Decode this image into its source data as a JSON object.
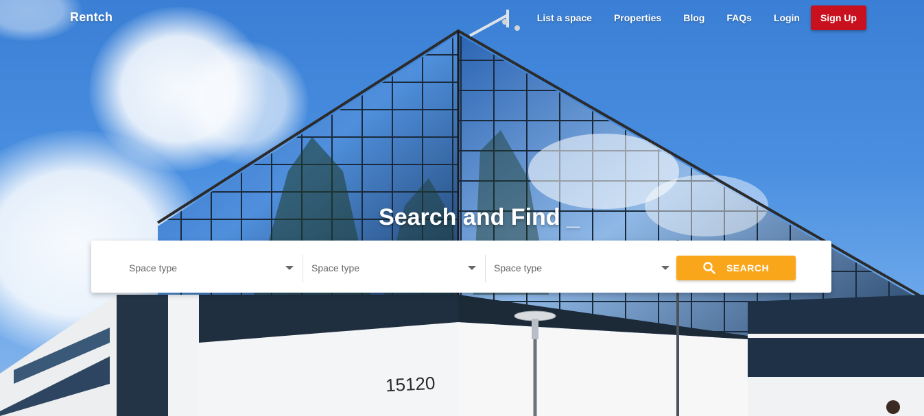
{
  "brand": {
    "name": "Rentch"
  },
  "nav": {
    "links": [
      "List a space",
      "Properties",
      "Blog",
      "FAQs",
      "Login"
    ],
    "signup_label": "Sign Up"
  },
  "hero": {
    "headline": "Search and Find _",
    "building_number": "15120"
  },
  "search": {
    "fields": [
      {
        "placeholder": "Space type"
      },
      {
        "placeholder": "Space type"
      },
      {
        "placeholder": "Space type"
      }
    ],
    "button_label": "SEARCH",
    "button_icon": "search-icon"
  },
  "colors": {
    "signup": "#c8101e",
    "search_button": "#f9a61a",
    "sky": "#3f82d3"
  }
}
